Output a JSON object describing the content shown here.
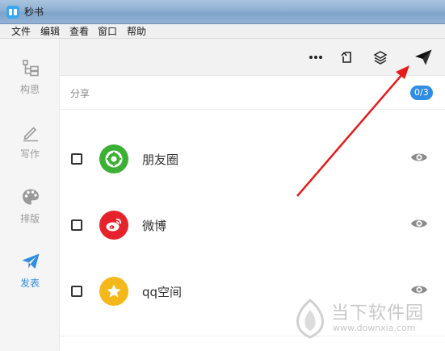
{
  "window": {
    "title": "秒书"
  },
  "menu": [
    "文件",
    "编辑",
    "查看",
    "窗口",
    "帮助"
  ],
  "sidebar": {
    "items": [
      {
        "label": "构思",
        "icon": "outline-icon",
        "active": false
      },
      {
        "label": "写作",
        "icon": "pen-icon",
        "active": false
      },
      {
        "label": "排版",
        "icon": "palette-icon",
        "active": false
      },
      {
        "label": "发表",
        "icon": "paper-plane-icon",
        "active": true
      }
    ]
  },
  "toolbar": {
    "buttons": [
      "more-icon",
      "export-icon",
      "layers-icon",
      "send-icon"
    ]
  },
  "share": {
    "title": "分享",
    "count": "0/3",
    "platforms": [
      {
        "name": "朋友圈",
        "color": "#3cb034",
        "icon": "wechat-moments-icon",
        "checked": false
      },
      {
        "name": "微博",
        "color": "#e6232c",
        "icon": "weibo-icon",
        "checked": false
      },
      {
        "name": "qq空间",
        "color": "#f4b81a",
        "icon": "qzone-icon",
        "checked": false
      }
    ]
  },
  "colors": {
    "accent": "#2f8de4",
    "annotation_arrow": "#e51c1c"
  },
  "watermark": {
    "text": "当下软件园",
    "url": "www.downxia.com"
  }
}
